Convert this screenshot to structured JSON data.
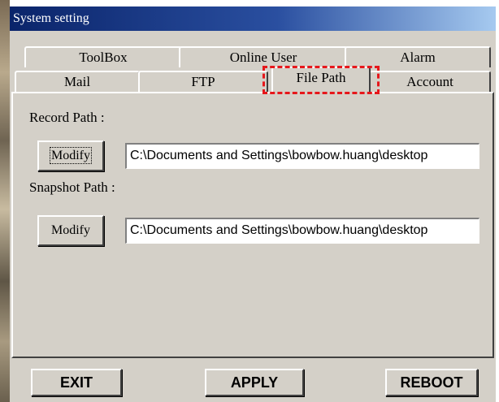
{
  "window": {
    "title": "System setting"
  },
  "tabs": {
    "back_row": [
      {
        "label": "ToolBox"
      },
      {
        "label": "Online User"
      },
      {
        "label": "Alarm"
      }
    ],
    "front_row": [
      {
        "label": "Mail"
      },
      {
        "label": "FTP"
      },
      {
        "label": "File Path",
        "active": true
      },
      {
        "label": "Account"
      }
    ]
  },
  "file_path": {
    "record_label": "Record Path :",
    "record_button": "Modify",
    "record_value": "C:\\Documents and Settings\\bowbow.huang\\desktop",
    "snapshot_label": "Snapshot Path :",
    "snapshot_button": "Modify",
    "snapshot_value": "C:\\Documents and Settings\\bowbow.huang\\desktop"
  },
  "footer": {
    "exit_label": "EXIT",
    "apply_label": "APPLY",
    "reboot_label": "REBOOT"
  },
  "colors": {
    "dialog_face": "#d4d0c8",
    "title_gradient_start": "#0a246a",
    "highlight_dash": "#e6171b"
  }
}
